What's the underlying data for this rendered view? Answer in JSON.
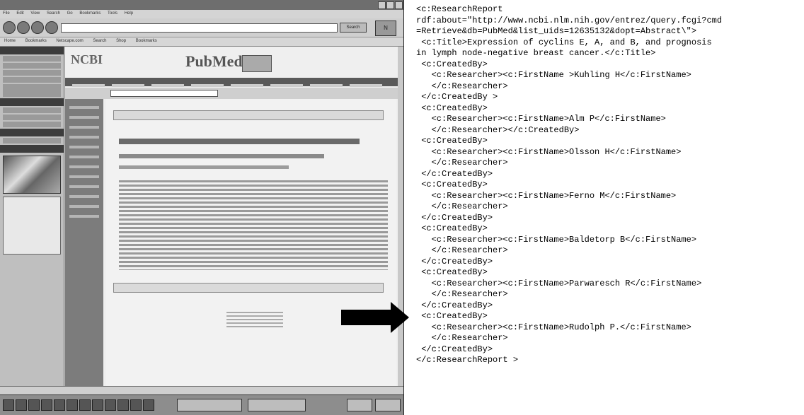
{
  "browser": {
    "menu_items": [
      "File",
      "Edit",
      "View",
      "Search",
      "Go",
      "Bookmarks",
      "Tools",
      "Help"
    ],
    "search_button": "Search",
    "bookmarks_items": [
      "Home",
      "Bookmarks",
      "Netscape.com",
      "Search",
      "Shop",
      "Bookmarks"
    ],
    "logo": "N"
  },
  "page": {
    "ncbi_logo": "NCBI",
    "pubmed_logo": "PubMed"
  },
  "xml_lines": [
    "<c:ResearchReport",
    "rdf:about=\"http://www.ncbi.nlm.nih.gov/entrez/query.fcgi?cmd",
    "=Retrieve&db=PubMed&list_uids=12635132&dopt=Abstract\\\">",
    " <c:Title>Expression of cyclins E, A, and B, and prognosis",
    "in lymph node-negative breast cancer.</c:Title>",
    " <c:CreatedBy>",
    "   <c:Researcher><c:FirstName >Kuhling H</c:FirstName>",
    "   </c:Researcher>",
    " </c:CreatedBy >",
    " <c:CreatedBy>",
    "   <c:Researcher><c:FirstName>Alm P</c:FirstName>",
    "   </c:Researcher></c:CreatedBy>",
    " <c:CreatedBy>",
    "   <c:Researcher><c:FirstName>Olsson H</c:FirstName>",
    "   </c:Researcher>",
    " </c:CreatedBy>",
    " <c:CreatedBy>",
    "   <c:Researcher><c:FirstName>Ferno M</c:FirstName>",
    "   </c:Researcher>",
    " </c:CreatedBy>",
    " <c:CreatedBy>",
    "   <c:Researcher><c:FirstName>Baldetorp B</c:FirstName>",
    "   </c:Researcher>",
    " </c:CreatedBy>",
    " <c:CreatedBy>",
    "   <c:Researcher><c:FirstName>Parwaresch R</c:FirstName>",
    "   </c:Researcher>",
    " </c:CreatedBy>",
    " <c:CreatedBy>",
    "   <c:Researcher><c:FirstName>Rudolph P.</c:FirstName>",
    "   </c:Researcher>",
    " </c:CreatedBy>",
    "</c:ResearchReport >"
  ]
}
